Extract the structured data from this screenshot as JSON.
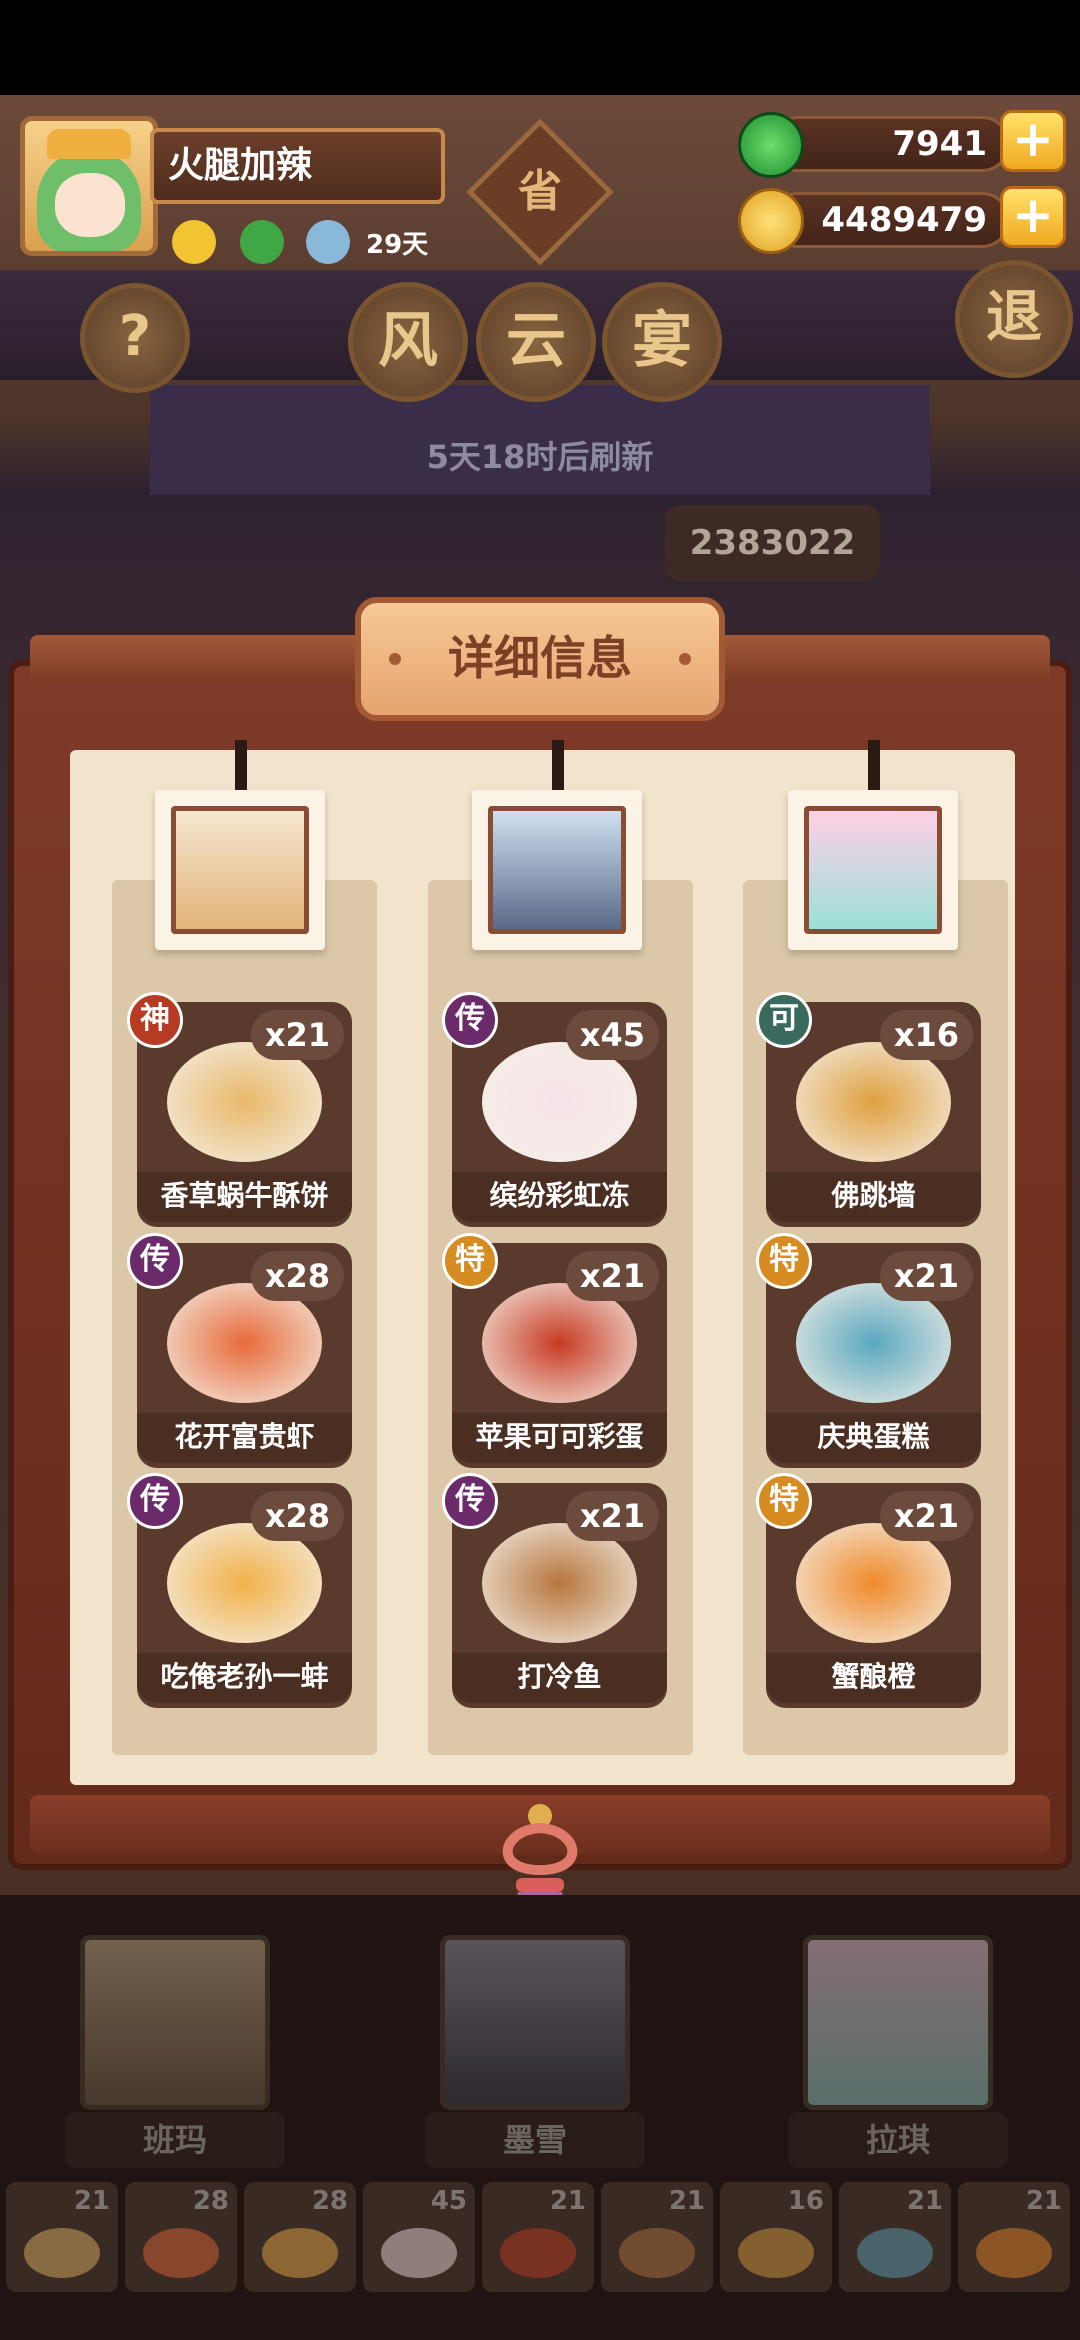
{
  "player": {
    "name": "火腿加辣",
    "days": "29天"
  },
  "currency": {
    "jade": "7941",
    "gold": "4489479",
    "plus": "+"
  },
  "event": {
    "badge": "省",
    "title_chars": [
      "风",
      "云",
      "宴"
    ],
    "refresh": "5天18时后刷新",
    "score_partial": "2383022",
    "help": "?",
    "exit": "退"
  },
  "modal": {
    "title": "详细信息",
    "columns": [
      {
        "dishes": [
          {
            "name": "香草蜗牛酥饼",
            "badge": "神",
            "count": "x21",
            "color": "#b63b22",
            "plate": "#e9b96a"
          },
          {
            "name": "花开富贵虾",
            "badge": "传",
            "count": "x28",
            "color": "#6b2b6a",
            "plate": "#e86a3a"
          },
          {
            "name": "吃俺老孙一蚌",
            "badge": "传",
            "count": "x28",
            "color": "#6b2b6a",
            "plate": "#f2b14a"
          }
        ]
      },
      {
        "dishes": [
          {
            "name": "缤纷彩虹冻",
            "badge": "传",
            "count": "x45",
            "color": "#6b2b6a",
            "plate": "#f6e4e8"
          },
          {
            "name": "苹果可可彩蛋",
            "badge": "特",
            "count": "x21",
            "color": "#d68c20",
            "plate": "#c83a22"
          },
          {
            "name": "打冷鱼",
            "badge": "传",
            "count": "x21",
            "color": "#6b2b6a",
            "plate": "#b8763e"
          }
        ]
      },
      {
        "dishes": [
          {
            "name": "佛跳墙",
            "badge": "可",
            "count": "x16",
            "color": "#3a6a5e",
            "plate": "#e0a040"
          },
          {
            "name": "庆典蛋糕",
            "badge": "特",
            "count": "x21",
            "color": "#d68c20",
            "plate": "#5aa8c0"
          },
          {
            "name": "蟹酿橙",
            "badge": "特",
            "count": "x21",
            "color": "#d68c20",
            "plate": "#f08a2a"
          }
        ]
      }
    ]
  },
  "characters": [
    "班玛",
    "墨雪",
    "拉琪"
  ],
  "tray": [
    "21",
    "28",
    "28",
    "45",
    "21",
    "21",
    "16",
    "21",
    "21"
  ]
}
